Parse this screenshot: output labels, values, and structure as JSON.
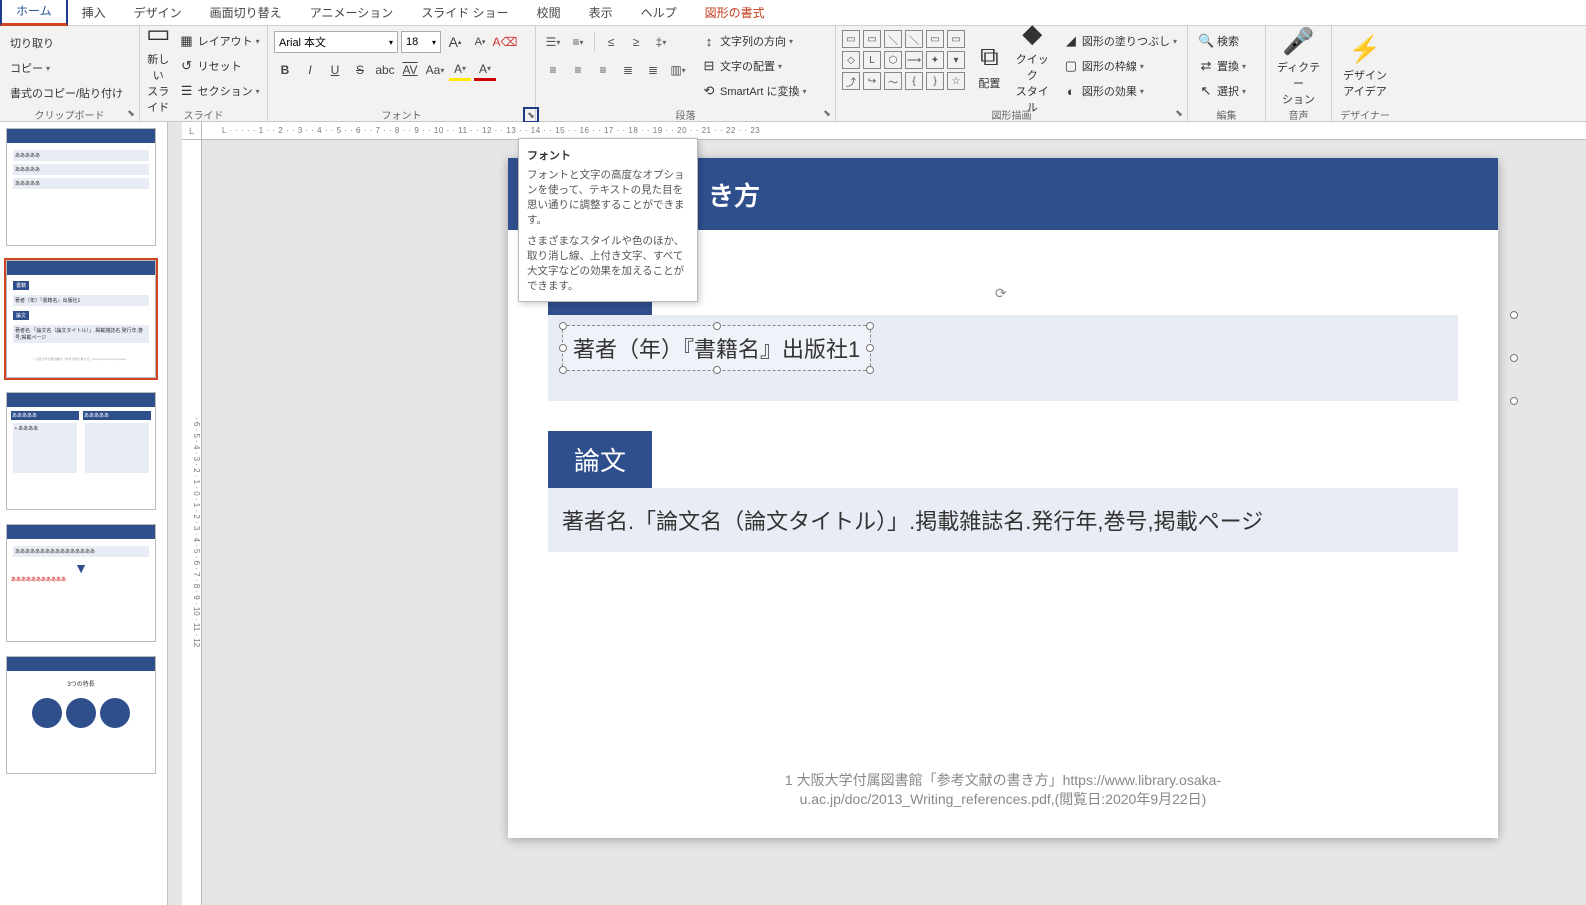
{
  "tabs": {
    "home": "ホーム",
    "insert": "挿入",
    "design": "デザイン",
    "transitions": "画面切り替え",
    "animations": "アニメーション",
    "slideshow": "スライド ショー",
    "review": "校閲",
    "view": "表示",
    "help": "ヘルプ",
    "shape_format": "図形の書式"
  },
  "clipboard": {
    "cut": "切り取り",
    "copy": "コピー",
    "format_painter": "書式のコピー/貼り付け",
    "group_label": "クリップボード"
  },
  "slides": {
    "new_slide": "新しい\nスライド",
    "layout": "レイアウト",
    "reset": "リセット",
    "section": "セクション",
    "group_label": "スライド"
  },
  "font": {
    "name": "Arial 本文",
    "size": "18",
    "grow": "A",
    "shrink": "A",
    "clear": "Aρ",
    "bold": "B",
    "italic": "I",
    "underline": "U",
    "strike": "S",
    "shadow": "abc",
    "spacing": "AV",
    "case": "Aa",
    "color_fill": "A",
    "color_font": "A",
    "group_label": "フォント"
  },
  "paragraph": {
    "group_label": "段落",
    "text_direction": "文字列の方向",
    "align_text": "文字の配置",
    "convert_smartart": "SmartArt に変換"
  },
  "drawing": {
    "arrange": "配置",
    "quick_styles": "クイック\nスタイル",
    "shape_fill": "図形の塗りつぶし",
    "shape_outline": "図形の枠線",
    "shape_effects": "図形の効果",
    "group_label": "図形描画"
  },
  "editing": {
    "find": "検索",
    "replace": "置換",
    "select": "選択",
    "group_label": "編集"
  },
  "voice": {
    "dictate": "ディクテー\nション",
    "group_label": "音声"
  },
  "designer": {
    "design_ideas": "デザイン\nアイデア",
    "group_label": "デザイナー"
  },
  "tooltip": {
    "title": "フォント",
    "body1": "フォントと文字の高度なオプションを使って、テキストの見た目を思い通りに調整することができます。",
    "body2": "さまざまなスタイルや色のほか、取り消し線、上付き文字、すべて大文字などの効果を加えることができます。"
  },
  "slide_content": {
    "header_suffix": "き方",
    "tag1": "書籍",
    "text1": "著者（年）『書籍名』出版社1",
    "tag2": "論文",
    "text2": "著者名.「論文名（論文タイトル）」.掲載雑誌名.発行年,巻号,掲載ページ",
    "footnote_line1": "1 大阪大学付属図書館「参考文献の書き方」https://www.library.osaka-",
    "footnote_line2": "u.ac.jp/doc/2013_Writing_references.pdf,(閲覧日:2020年9月22日)"
  },
  "ruler_h": "L · · · · · 1 · · 2 · · 3 · · 4 · · 5 · · 6 · · 7 · · 8 · · 9 · · 10 · · 11 · · 12 · · 13 · · 14 · · 15 · · 16 · · 17 · · 18 · · 19 · · 20 · · 21 · · 22 · · 23",
  "ruler_v": "· 6 · 5 · 4 · 3 · 2 · 1 · 0 · 1 · 2 · 3 · 4 · 5 · 6 · 7 · 8 · 9 · 10 · 11 · 12",
  "thumbs": {
    "t2_line": "あああああ",
    "t3_line": "ああああああああああああああああ",
    "t3_red": "あああああああああああ"
  }
}
